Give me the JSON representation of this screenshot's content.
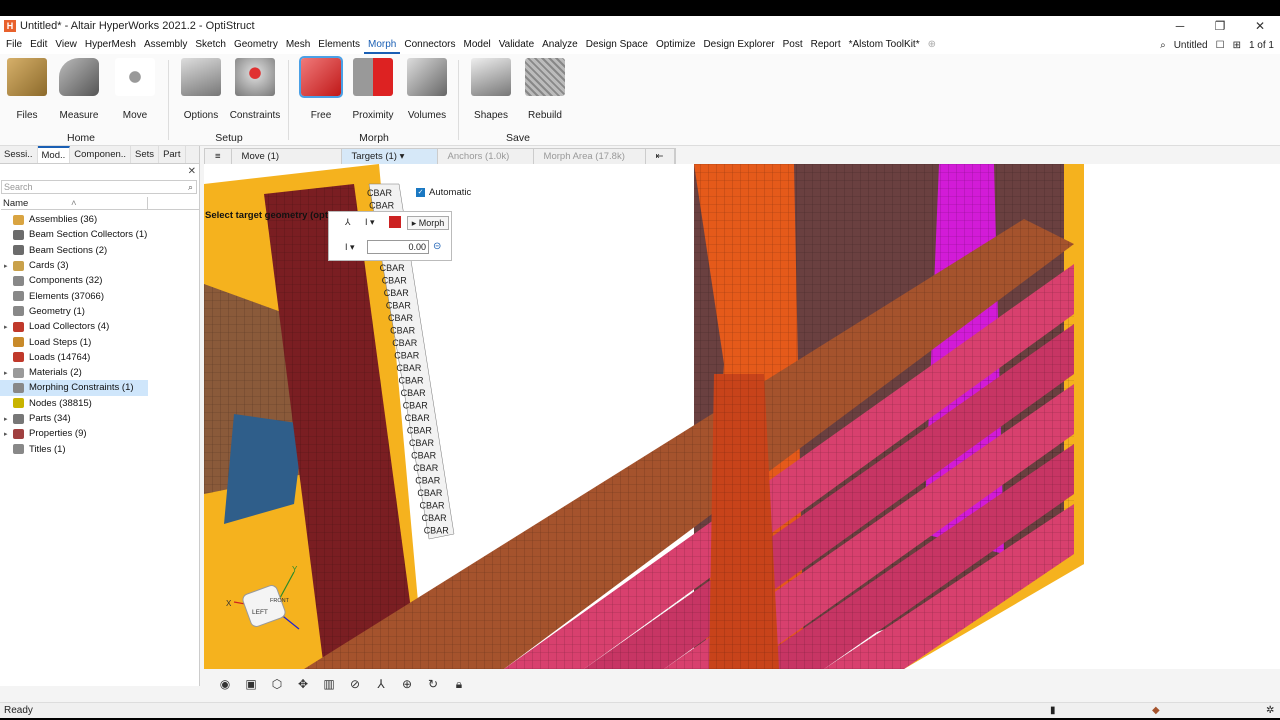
{
  "window": {
    "title": "Untitled* - Altair HyperWorks 2021.2 - OptiStruct",
    "app_icon": "H",
    "minimize": "─",
    "maximize": "❐",
    "close": "✕"
  },
  "menu": {
    "items": [
      "File",
      "Edit",
      "View",
      "HyperMesh",
      "Assembly",
      "Sketch",
      "Geometry",
      "Mesh",
      "Elements",
      "Morph",
      "Connectors",
      "Model",
      "Validate",
      "Analyze",
      "Design Space",
      "Optimize",
      "Design Explorer",
      "Post",
      "Report",
      "*Alstom ToolKit*"
    ],
    "active": "Morph",
    "session_name": "Untitled",
    "page_counter": "1 of 1"
  },
  "ribbon": {
    "groups": [
      {
        "label": "Home",
        "tools": [
          "Files",
          "Measure",
          "Move"
        ]
      },
      {
        "label": "Setup",
        "tools": [
          "Options",
          "Constraints"
        ]
      },
      {
        "label": "Morph",
        "tools": [
          "Free",
          "Proximity",
          "Volumes"
        ]
      },
      {
        "label": "Save",
        "tools": [
          "Shapes",
          "Rebuild"
        ]
      }
    ]
  },
  "left_panel": {
    "tabs": [
      "Sessi..",
      "Mod..",
      "Componen..",
      "Sets",
      "Part"
    ],
    "active_tab": "Mod..",
    "search_placeholder": "Search",
    "col_name": "Name",
    "items": [
      {
        "label": "Assemblies  (36)",
        "expand": false,
        "color": "#d9a441"
      },
      {
        "label": "Beam Section Collectors  (1)",
        "expand": false,
        "color": "#6b6b6b"
      },
      {
        "label": "Beam Sections  (2)",
        "expand": false,
        "color": "#6b6b6b"
      },
      {
        "label": "Cards  (3)",
        "expand": true,
        "color": "#c9a14a"
      },
      {
        "label": "Components  (32)",
        "expand": false,
        "color": "#888888"
      },
      {
        "label": "Elements  (37066)",
        "expand": false,
        "color": "#888888"
      },
      {
        "label": "Geometry  (1)",
        "expand": false,
        "color": "#888888"
      },
      {
        "label": "Load Collectors  (4)",
        "expand": true,
        "color": "#c0392b"
      },
      {
        "label": "Load Steps  (1)",
        "expand": false,
        "color": "#c88a2a"
      },
      {
        "label": "Loads  (14764)",
        "expand": false,
        "color": "#c0392b"
      },
      {
        "label": "Materials  (2)",
        "expand": true,
        "color": "#9a9a9a"
      },
      {
        "label": "Morphing Constraints  (1)",
        "expand": false,
        "color": "#888888",
        "selected": true
      },
      {
        "label": "Nodes  (38815)",
        "expand": false,
        "color": "#c8b400"
      },
      {
        "label": "Parts  (34)",
        "expand": true,
        "color": "#777777"
      },
      {
        "label": "Properties  (9)",
        "expand": true,
        "color": "#a04040"
      },
      {
        "label": "Titles  (1)",
        "expand": false,
        "color": "#888888"
      }
    ]
  },
  "viewport": {
    "toolbar": [
      "≡",
      "Move (1)",
      "Targets (1) ▾",
      "Anchors (1.0k)",
      "Morph Area (17.8k)",
      "⇤"
    ],
    "hint": "Select target geometry (optional).",
    "automatic_label": "Automatic",
    "morph_button": "▸ Morph",
    "morph_value": "0.00",
    "axis_x": "X",
    "axis_y": "Y",
    "cube_left": "LEFT",
    "cube_front": "FRONT",
    "cbar_label": "CBAR"
  },
  "status": {
    "text": "Ready"
  },
  "colors": {
    "accent": "#1a5fb4",
    "yellow": "#f5b21e",
    "pink": "#d8406e",
    "magenta": "#d21bd7",
    "orange": "#f06a1e",
    "maroon": "#7a1e22",
    "brown": "#a5532d"
  }
}
